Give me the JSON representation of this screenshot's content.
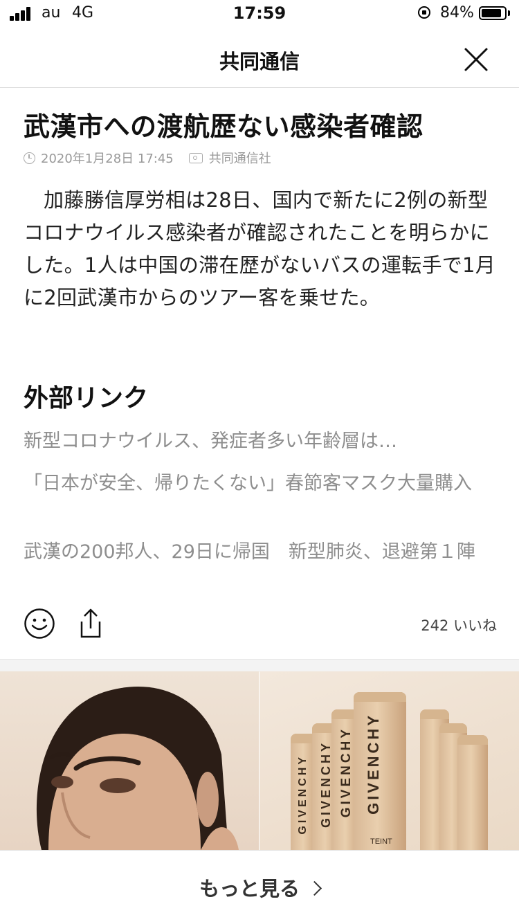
{
  "status_bar": {
    "carrier": "au",
    "network": "4G",
    "time": "17:59",
    "battery": "84%"
  },
  "nav": {
    "title": "共同通信"
  },
  "article": {
    "headline": "武漢市への渡航歴ない感染者確認",
    "date": "2020年1月28日 17:45",
    "source": "共同通信社",
    "body": "加藤勝信厚労相は28日、国内で新たに2例の新型コロナウイルス感染者が確認されたことを明らかにした。1人は中国の滞在歴がないバスの運転手で1月に2回武漢市からのツアー客を乗せた。"
  },
  "external_links": {
    "title": "外部リンク",
    "items": [
      {
        "label": "新型コロナウイルス、発症者多い年齢層は…"
      },
      {
        "label": "「日本が安全、帰りたくない」春節客マスク大量購入"
      },
      {
        "label": "武漢の200邦人、29日に帰国　新型肺炎、退避第１陣"
      }
    ]
  },
  "actions": {
    "likes": "242 いいね",
    "icons": [
      "smile-icon",
      "share-icon"
    ]
  },
  "ad": {
    "brand": "GIVENCHY",
    "sub": "TEINT"
  },
  "bottom": {
    "more_label": "もっと見る"
  }
}
